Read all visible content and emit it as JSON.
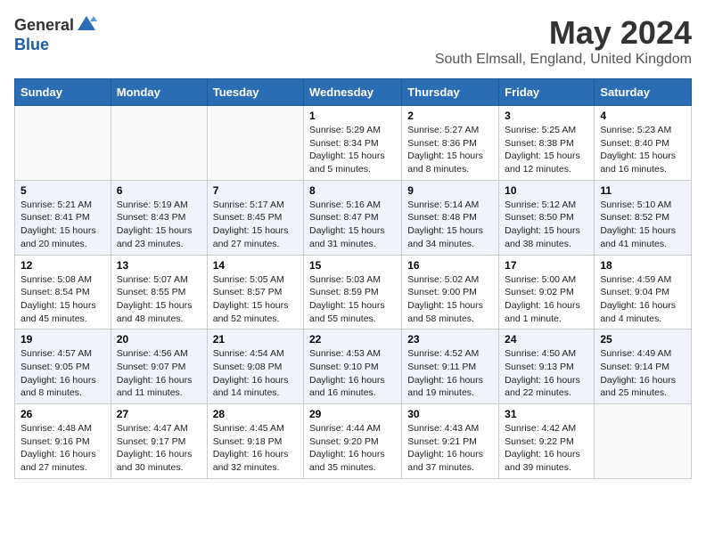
{
  "header": {
    "logo_general": "General",
    "logo_blue": "Blue",
    "title": "May 2024",
    "subtitle": "South Elmsall, England, United Kingdom"
  },
  "days_of_week": [
    "Sunday",
    "Monday",
    "Tuesday",
    "Wednesday",
    "Thursday",
    "Friday",
    "Saturday"
  ],
  "weeks": [
    [
      {
        "day": "",
        "info": ""
      },
      {
        "day": "",
        "info": ""
      },
      {
        "day": "",
        "info": ""
      },
      {
        "day": "1",
        "info": "Sunrise: 5:29 AM\nSunset: 8:34 PM\nDaylight: 15 hours\nand 5 minutes."
      },
      {
        "day": "2",
        "info": "Sunrise: 5:27 AM\nSunset: 8:36 PM\nDaylight: 15 hours\nand 8 minutes."
      },
      {
        "day": "3",
        "info": "Sunrise: 5:25 AM\nSunset: 8:38 PM\nDaylight: 15 hours\nand 12 minutes."
      },
      {
        "day": "4",
        "info": "Sunrise: 5:23 AM\nSunset: 8:40 PM\nDaylight: 15 hours\nand 16 minutes."
      }
    ],
    [
      {
        "day": "5",
        "info": "Sunrise: 5:21 AM\nSunset: 8:41 PM\nDaylight: 15 hours\nand 20 minutes."
      },
      {
        "day": "6",
        "info": "Sunrise: 5:19 AM\nSunset: 8:43 PM\nDaylight: 15 hours\nand 23 minutes."
      },
      {
        "day": "7",
        "info": "Sunrise: 5:17 AM\nSunset: 8:45 PM\nDaylight: 15 hours\nand 27 minutes."
      },
      {
        "day": "8",
        "info": "Sunrise: 5:16 AM\nSunset: 8:47 PM\nDaylight: 15 hours\nand 31 minutes."
      },
      {
        "day": "9",
        "info": "Sunrise: 5:14 AM\nSunset: 8:48 PM\nDaylight: 15 hours\nand 34 minutes."
      },
      {
        "day": "10",
        "info": "Sunrise: 5:12 AM\nSunset: 8:50 PM\nDaylight: 15 hours\nand 38 minutes."
      },
      {
        "day": "11",
        "info": "Sunrise: 5:10 AM\nSunset: 8:52 PM\nDaylight: 15 hours\nand 41 minutes."
      }
    ],
    [
      {
        "day": "12",
        "info": "Sunrise: 5:08 AM\nSunset: 8:54 PM\nDaylight: 15 hours\nand 45 minutes."
      },
      {
        "day": "13",
        "info": "Sunrise: 5:07 AM\nSunset: 8:55 PM\nDaylight: 15 hours\nand 48 minutes."
      },
      {
        "day": "14",
        "info": "Sunrise: 5:05 AM\nSunset: 8:57 PM\nDaylight: 15 hours\nand 52 minutes."
      },
      {
        "day": "15",
        "info": "Sunrise: 5:03 AM\nSunset: 8:59 PM\nDaylight: 15 hours\nand 55 minutes."
      },
      {
        "day": "16",
        "info": "Sunrise: 5:02 AM\nSunset: 9:00 PM\nDaylight: 15 hours\nand 58 minutes."
      },
      {
        "day": "17",
        "info": "Sunrise: 5:00 AM\nSunset: 9:02 PM\nDaylight: 16 hours\nand 1 minute."
      },
      {
        "day": "18",
        "info": "Sunrise: 4:59 AM\nSunset: 9:04 PM\nDaylight: 16 hours\nand 4 minutes."
      }
    ],
    [
      {
        "day": "19",
        "info": "Sunrise: 4:57 AM\nSunset: 9:05 PM\nDaylight: 16 hours\nand 8 minutes."
      },
      {
        "day": "20",
        "info": "Sunrise: 4:56 AM\nSunset: 9:07 PM\nDaylight: 16 hours\nand 11 minutes."
      },
      {
        "day": "21",
        "info": "Sunrise: 4:54 AM\nSunset: 9:08 PM\nDaylight: 16 hours\nand 14 minutes."
      },
      {
        "day": "22",
        "info": "Sunrise: 4:53 AM\nSunset: 9:10 PM\nDaylight: 16 hours\nand 16 minutes."
      },
      {
        "day": "23",
        "info": "Sunrise: 4:52 AM\nSunset: 9:11 PM\nDaylight: 16 hours\nand 19 minutes."
      },
      {
        "day": "24",
        "info": "Sunrise: 4:50 AM\nSunset: 9:13 PM\nDaylight: 16 hours\nand 22 minutes."
      },
      {
        "day": "25",
        "info": "Sunrise: 4:49 AM\nSunset: 9:14 PM\nDaylight: 16 hours\nand 25 minutes."
      }
    ],
    [
      {
        "day": "26",
        "info": "Sunrise: 4:48 AM\nSunset: 9:16 PM\nDaylight: 16 hours\nand 27 minutes."
      },
      {
        "day": "27",
        "info": "Sunrise: 4:47 AM\nSunset: 9:17 PM\nDaylight: 16 hours\nand 30 minutes."
      },
      {
        "day": "28",
        "info": "Sunrise: 4:45 AM\nSunset: 9:18 PM\nDaylight: 16 hours\nand 32 minutes."
      },
      {
        "day": "29",
        "info": "Sunrise: 4:44 AM\nSunset: 9:20 PM\nDaylight: 16 hours\nand 35 minutes."
      },
      {
        "day": "30",
        "info": "Sunrise: 4:43 AM\nSunset: 9:21 PM\nDaylight: 16 hours\nand 37 minutes."
      },
      {
        "day": "31",
        "info": "Sunrise: 4:42 AM\nSunset: 9:22 PM\nDaylight: 16 hours\nand 39 minutes."
      },
      {
        "day": "",
        "info": ""
      }
    ]
  ]
}
